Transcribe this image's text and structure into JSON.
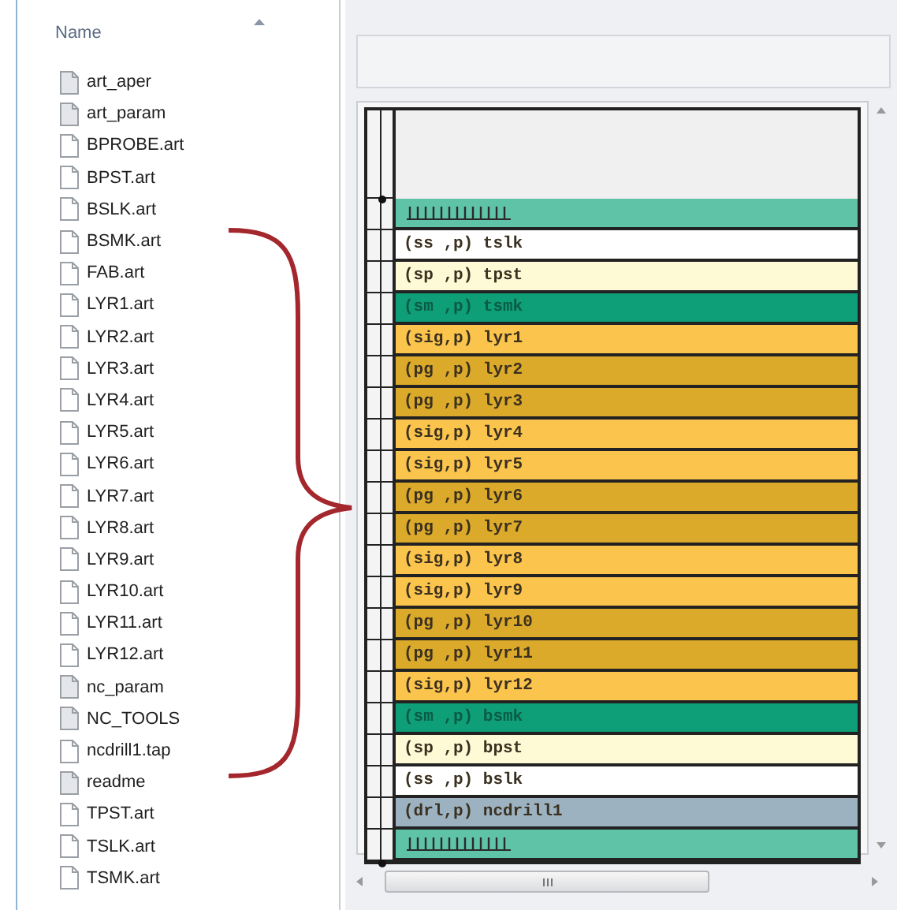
{
  "file_list": {
    "column_header": "Name",
    "files": [
      {
        "name": "art_aper",
        "kind": "data"
      },
      {
        "name": "art_param",
        "kind": "data"
      },
      {
        "name": "BPROBE.art",
        "kind": "doc"
      },
      {
        "name": "BPST.art",
        "kind": "doc"
      },
      {
        "name": "BSLK.art",
        "kind": "doc"
      },
      {
        "name": "BSMK.art",
        "kind": "doc"
      },
      {
        "name": "FAB.art",
        "kind": "doc"
      },
      {
        "name": "LYR1.art",
        "kind": "doc"
      },
      {
        "name": "LYR2.art",
        "kind": "doc"
      },
      {
        "name": "LYR3.art",
        "kind": "doc"
      },
      {
        "name": "LYR4.art",
        "kind": "doc"
      },
      {
        "name": "LYR5.art",
        "kind": "doc"
      },
      {
        "name": "LYR6.art",
        "kind": "doc"
      },
      {
        "name": "LYR7.art",
        "kind": "doc"
      },
      {
        "name": "LYR8.art",
        "kind": "doc"
      },
      {
        "name": "LYR9.art",
        "kind": "doc"
      },
      {
        "name": "LYR10.art",
        "kind": "doc"
      },
      {
        "name": "LYR11.art",
        "kind": "doc"
      },
      {
        "name": "LYR12.art",
        "kind": "doc"
      },
      {
        "name": "nc_param",
        "kind": "data"
      },
      {
        "name": "NC_TOOLS",
        "kind": "data"
      },
      {
        "name": "ncdrill1.tap",
        "kind": "doc"
      },
      {
        "name": "readme",
        "kind": "data"
      },
      {
        "name": "TPST.art",
        "kind": "doc"
      },
      {
        "name": "TSLK.art",
        "kind": "doc"
      },
      {
        "name": "TSMK.art",
        "kind": "doc"
      }
    ]
  },
  "stackup": {
    "rows": [
      {
        "kind": "hatch",
        "color": "#5fc3a8"
      },
      {
        "kind": "layer",
        "label": "(ss ,p) tslk",
        "color": "#ffffff"
      },
      {
        "kind": "layer",
        "label": "(sp ,p) tpst",
        "color": "#fffad6"
      },
      {
        "kind": "layer",
        "label": "(sm ,p) tsmk",
        "color": "#0e9e78"
      },
      {
        "kind": "layer",
        "label": "(sig,p) lyr1",
        "color": "#fbc44c"
      },
      {
        "kind": "layer",
        "label": "(pg ,p) lyr2",
        "color": "#dcaa2a"
      },
      {
        "kind": "layer",
        "label": "(pg ,p) lyr3",
        "color": "#dcaa2a"
      },
      {
        "kind": "layer",
        "label": "(sig,p) lyr4",
        "color": "#fbc44c"
      },
      {
        "kind": "layer",
        "label": "(sig,p) lyr5",
        "color": "#fbc44c"
      },
      {
        "kind": "layer",
        "label": "(pg ,p) lyr6",
        "color": "#dcaa2a"
      },
      {
        "kind": "layer",
        "label": "(pg ,p) lyr7",
        "color": "#dcaa2a"
      },
      {
        "kind": "layer",
        "label": "(sig,p) lyr8",
        "color": "#fbc44c"
      },
      {
        "kind": "layer",
        "label": "(sig,p) lyr9",
        "color": "#fbc44c"
      },
      {
        "kind": "layer",
        "label": "(pg ,p) lyr10",
        "color": "#dcaa2a"
      },
      {
        "kind": "layer",
        "label": "(pg ,p) lyr11",
        "color": "#dcaa2a"
      },
      {
        "kind": "layer",
        "label": "(sig,p) lyr12",
        "color": "#fbc44c"
      },
      {
        "kind": "layer",
        "label": "(sm ,p) bsmk",
        "color": "#0e9e78"
      },
      {
        "kind": "layer",
        "label": "(sp ,p) bpst",
        "color": "#fffad6"
      },
      {
        "kind": "layer",
        "label": "(ss ,p) bslk",
        "color": "#ffffff"
      },
      {
        "kind": "layer",
        "label": "(drl,p) ncdrill1",
        "color": "#9db2c1"
      },
      {
        "kind": "hatch",
        "color": "#5fc3a8"
      }
    ]
  }
}
